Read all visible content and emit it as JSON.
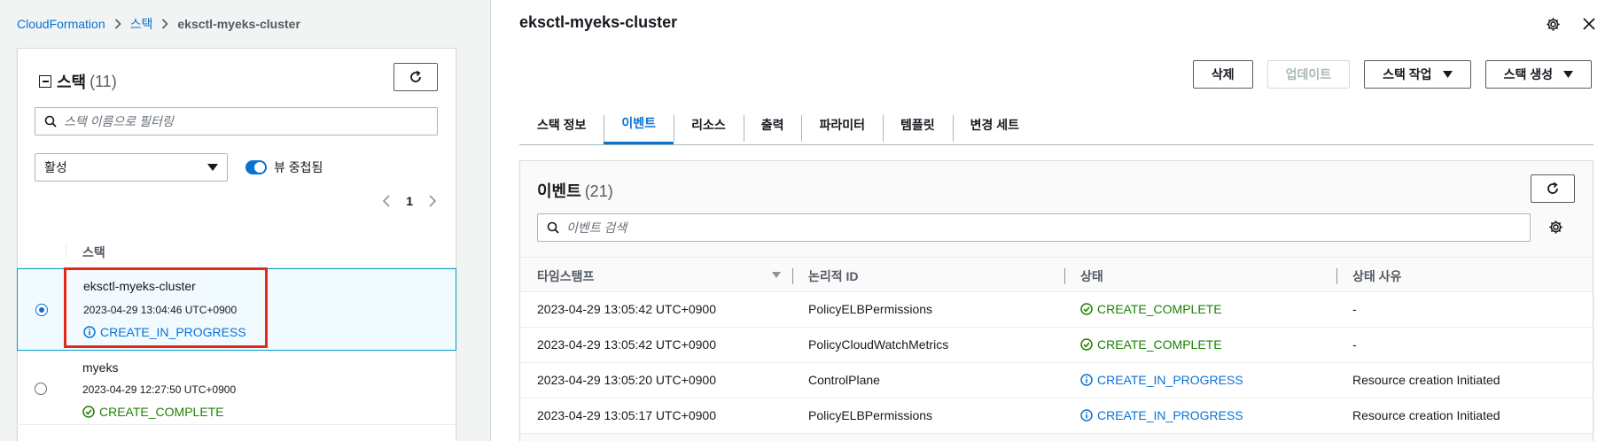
{
  "breadcrumb": {
    "root": "CloudFormation",
    "stacks": "스택",
    "current": "eksctl-myeks-cluster"
  },
  "stack_list": {
    "title": "스택",
    "count": "(11)",
    "filter_placeholder": "스택 이름으로 필터링",
    "status_filter": "활성",
    "nested_view_label": "뷰 중첩됨",
    "nested_view_on": true,
    "page": "1",
    "column_header": "스택",
    "rows": [
      {
        "name": "eksctl-myeks-cluster",
        "date": "2023-04-29 13:04:46 UTC+0900",
        "status": "CREATE_IN_PROGRESS",
        "selected": true
      },
      {
        "name": "myeks",
        "date": "2023-04-29 12:27:50 UTC+0900",
        "status": "CREATE_COMPLETE",
        "selected": false
      }
    ]
  },
  "detail": {
    "title": "eksctl-myeks-cluster",
    "actions": {
      "delete": "삭제",
      "update": "업데이트",
      "stack_actions": "스택 작업",
      "create_stack": "스택 생성"
    },
    "tabs": [
      "스택 정보",
      "이벤트",
      "리소스",
      "출력",
      "파라미터",
      "템플릿",
      "변경 세트"
    ],
    "active_tab": "이벤트"
  },
  "events": {
    "title": "이벤트",
    "count": "(21)",
    "search_placeholder": "이벤트 검색",
    "columns": [
      "타임스탬프",
      "논리적 ID",
      "상태",
      "상태 사유"
    ],
    "rows": [
      {
        "timestamp": "2023-04-29 13:05:42 UTC+0900",
        "logical_id": "PolicyELBPermissions",
        "status": "CREATE_COMPLETE",
        "reason": "-"
      },
      {
        "timestamp": "2023-04-29 13:05:42 UTC+0900",
        "logical_id": "PolicyCloudWatchMetrics",
        "status": "CREATE_COMPLETE",
        "reason": "-"
      },
      {
        "timestamp": "2023-04-29 13:05:20 UTC+0900",
        "logical_id": "ControlPlane",
        "status": "CREATE_IN_PROGRESS",
        "reason": "Resource creation Initiated"
      },
      {
        "timestamp": "2023-04-29 13:05:17 UTC+0900",
        "logical_id": "PolicyELBPermissions",
        "status": "CREATE_IN_PROGRESS",
        "reason": "Resource creation Initiated"
      }
    ]
  },
  "colors": {
    "link": "#0972d3",
    "success": "#1d8102",
    "highlight_box": "#e32a1a",
    "selected_row_bg": "#f1faff"
  }
}
